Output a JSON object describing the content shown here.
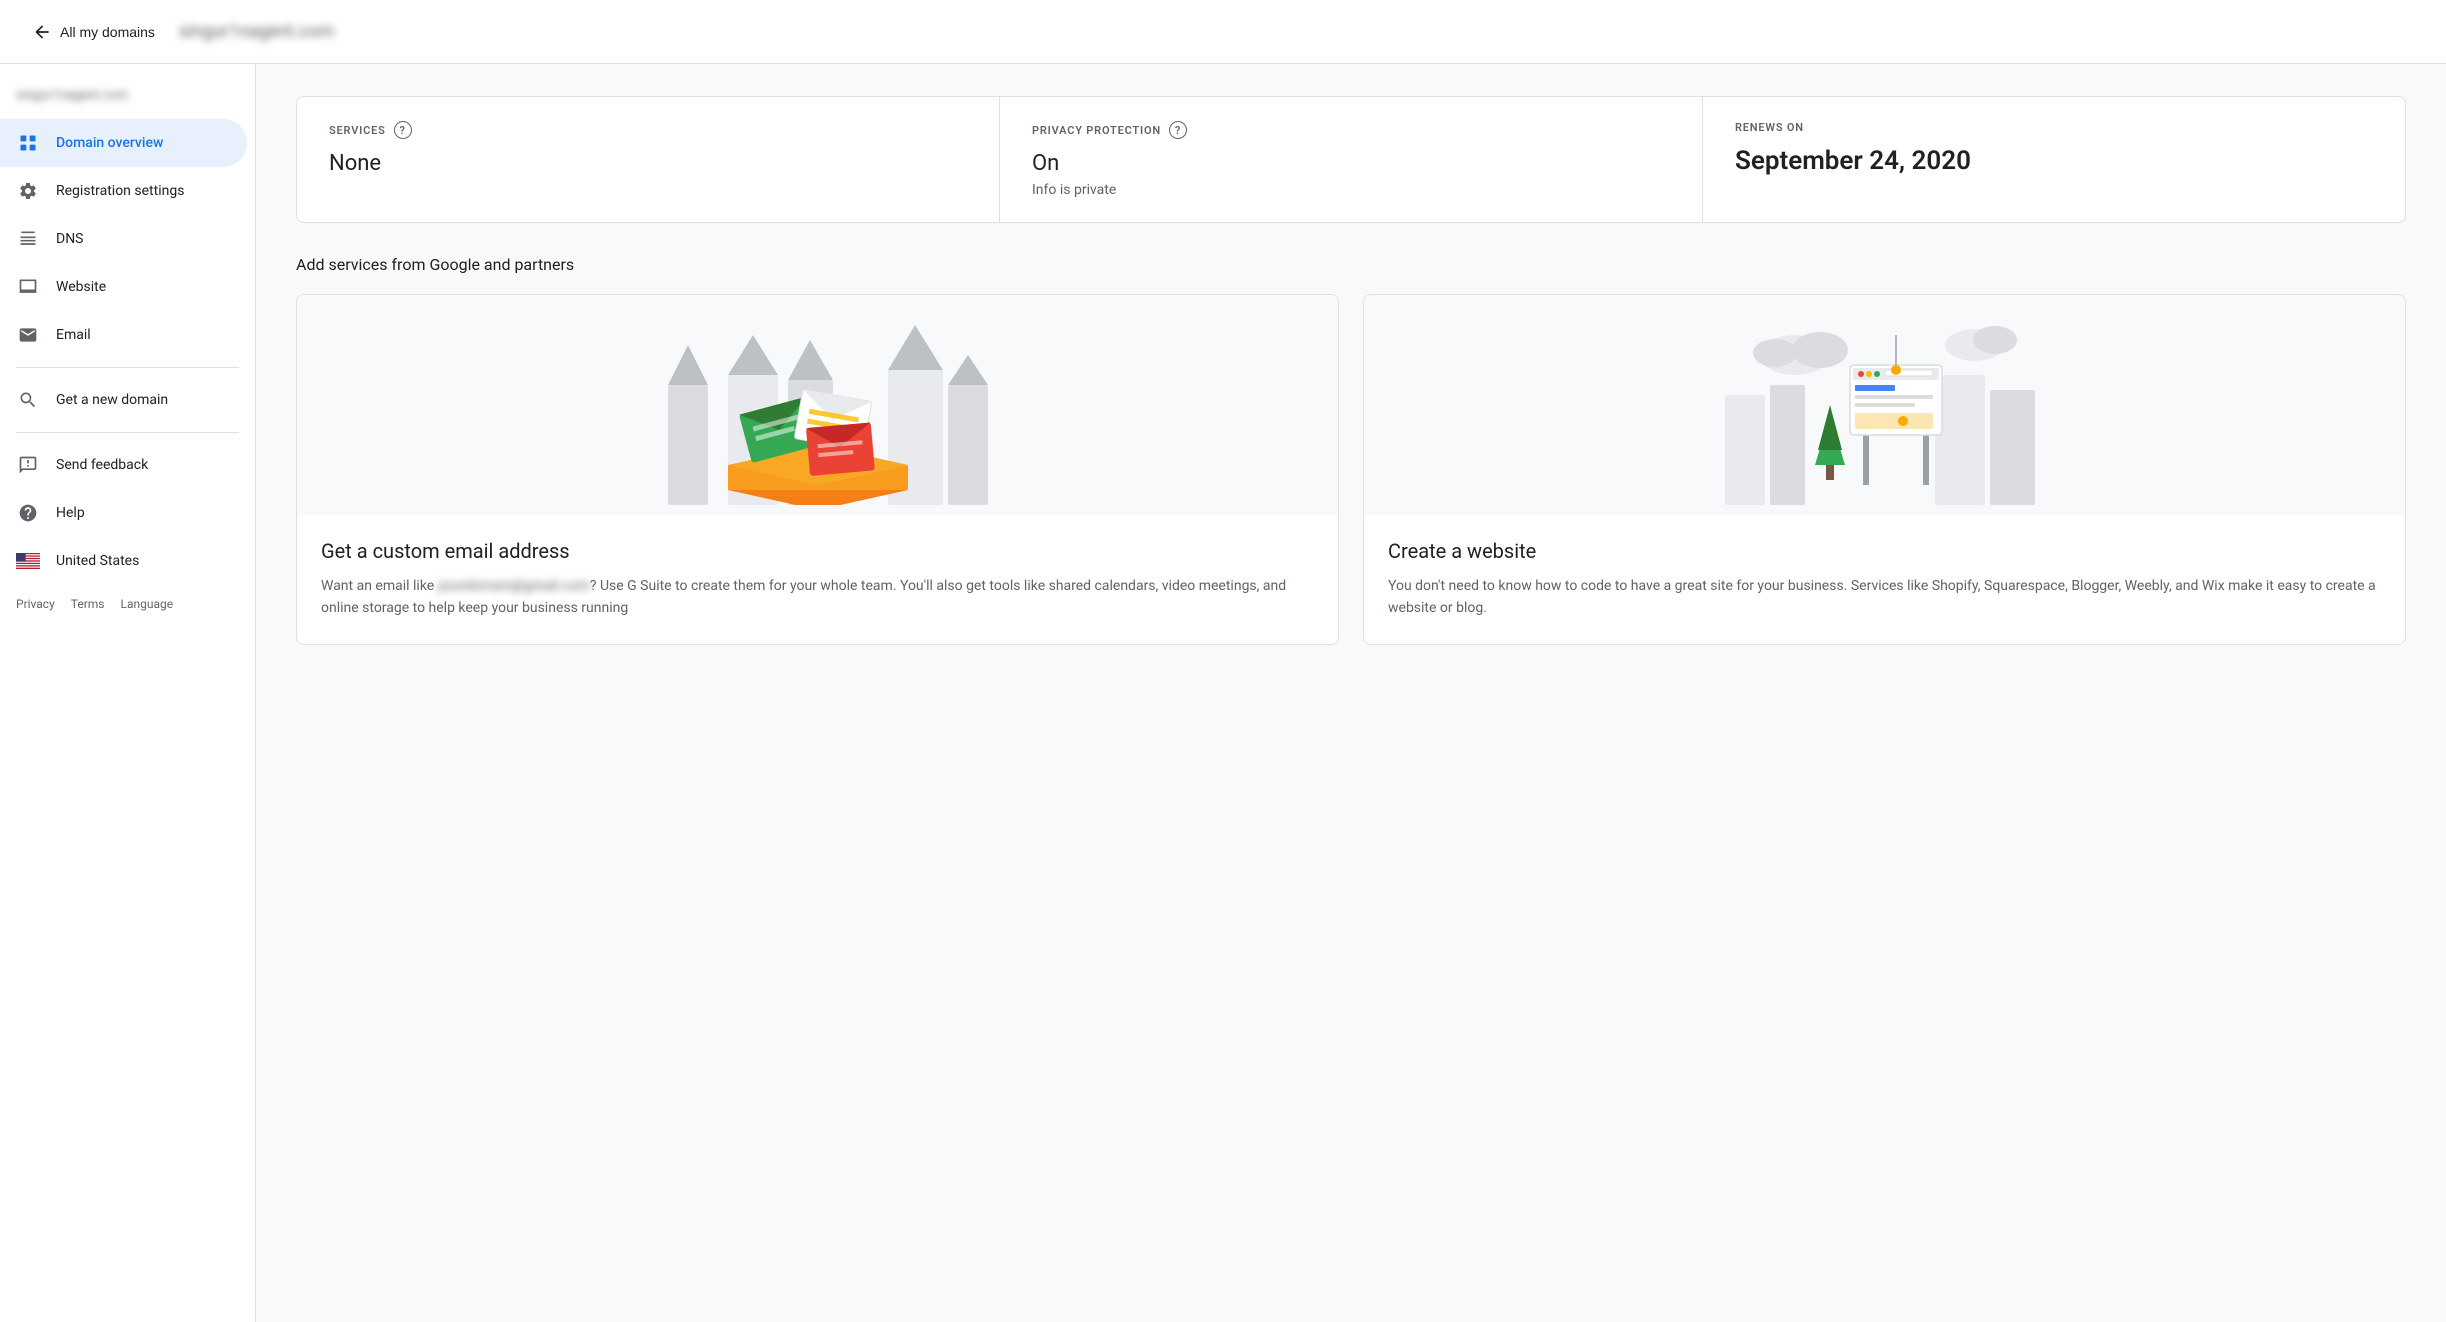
{
  "header": {
    "back_label": "All my domains",
    "domain_name": "example@gmail.com"
  },
  "sidebar": {
    "domain": "example@gmail.com",
    "nav_items": [
      {
        "id": "domain-overview",
        "label": "Domain overview",
        "icon": "grid-icon",
        "active": true
      },
      {
        "id": "registration-settings",
        "label": "Registration settings",
        "icon": "settings-icon",
        "active": false
      },
      {
        "id": "dns",
        "label": "DNS",
        "icon": "dns-icon",
        "active": false
      },
      {
        "id": "website",
        "label": "Website",
        "icon": "website-icon",
        "active": false
      },
      {
        "id": "email",
        "label": "Email",
        "icon": "email-icon",
        "active": false
      }
    ],
    "secondary_items": [
      {
        "id": "get-new-domain",
        "label": "Get a new domain",
        "icon": "search-icon"
      },
      {
        "id": "send-feedback",
        "label": "Send feedback",
        "icon": "feedback-icon"
      },
      {
        "id": "help",
        "label": "Help",
        "icon": "help-icon"
      },
      {
        "id": "united-states",
        "label": "United States",
        "icon": "flag-icon"
      }
    ],
    "footer": {
      "privacy": "Privacy",
      "terms": "Terms",
      "language": "Language"
    }
  },
  "info_card": {
    "services": {
      "label": "SERVICES",
      "value": "None"
    },
    "privacy_protection": {
      "label": "PRIVACY PROTECTION",
      "value": "On",
      "subvalue": "Info is private"
    },
    "renews_on": {
      "label": "RENEWS ON",
      "value": "September 24, 2020"
    }
  },
  "services_section": {
    "title": "Add services from Google and partners",
    "cards": [
      {
        "id": "email-card",
        "title": "Get a custom email address",
        "description": "Want an email like you@yourdomain.com? Use G Suite to create them for your whole team. You'll also get tools like shared calendars, video meetings, and online storage to help keep your business running"
      },
      {
        "id": "website-card",
        "title": "Create a website",
        "description": "You don't need to know how to code to have a great site for your business. Services like Shopify, Squarespace, Blogger, Weebly, and Wix make it easy to create a website or blog."
      }
    ]
  }
}
